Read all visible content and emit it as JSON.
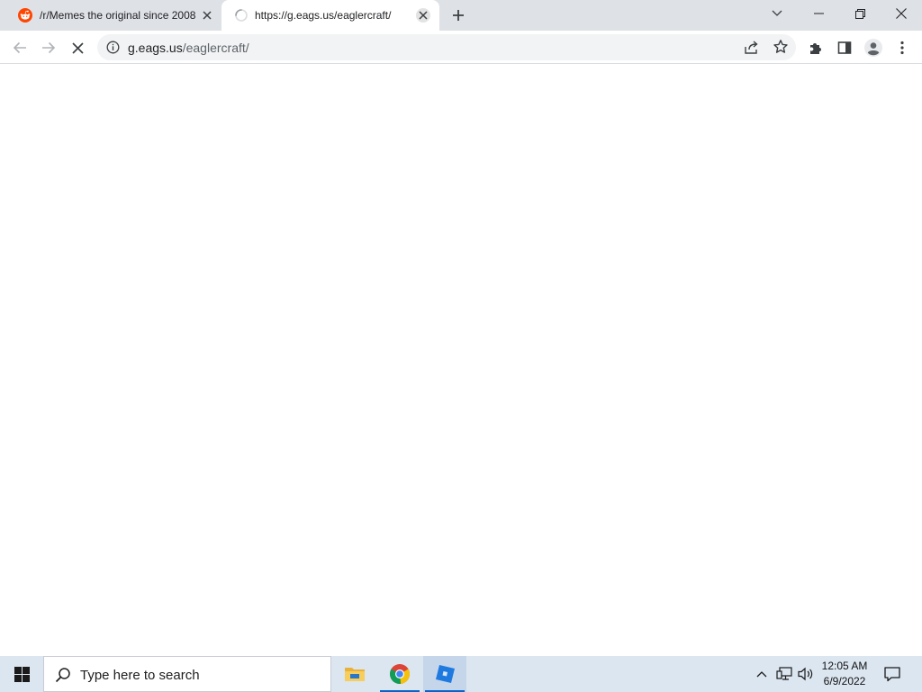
{
  "browser": {
    "tabs": [
      {
        "title": "/r/Memes the original since 2008",
        "favicon": "reddit-icon",
        "active": false
      },
      {
        "title": "https://g.eags.us/eaglercraft/",
        "favicon": "loading-spinner-icon",
        "active": true
      }
    ],
    "address_bar": {
      "host": "g.eags.us",
      "path": "/eaglercraft/"
    }
  },
  "taskbar": {
    "search_placeholder": "Type here to search",
    "apps": [
      "file-explorer-icon",
      "chrome-icon",
      "roblox-icon"
    ],
    "clock": {
      "time": "12:05 AM",
      "date": "6/9/2022"
    }
  },
  "colors": {
    "tabstrip": "#dee1e6",
    "taskbar": "#dce6f1",
    "reddit": "#ff4500",
    "accent": "#0a64c8"
  }
}
